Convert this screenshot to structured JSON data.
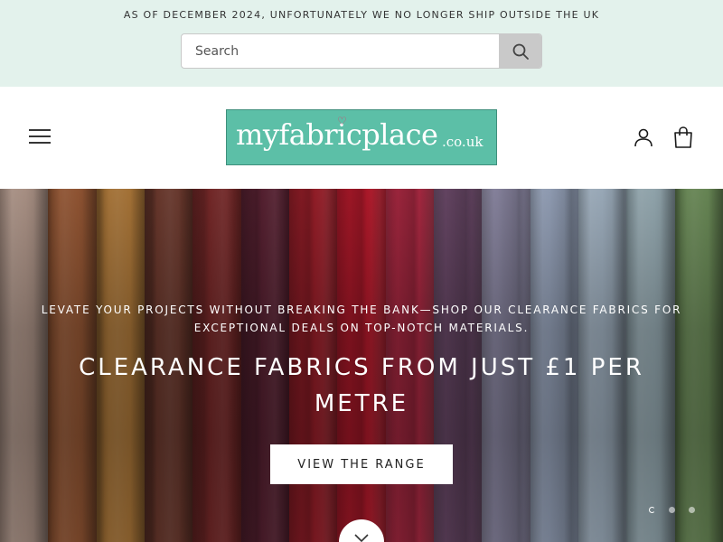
{
  "announcement": {
    "text": "AS OF DECEMBER 2024, UNFORTUNATELY WE NO LONGER SHIP OUTSIDE THE UK"
  },
  "search": {
    "placeholder": "Search",
    "value": ""
  },
  "header": {
    "logo": {
      "name": "myfabricplace",
      "tld": ".co.uk"
    }
  },
  "hero": {
    "subtitle": "LEVATE YOUR PROJECTS WITHOUT BREAKING THE BANK—SHOP OUR CLEARANCE FABRICS FOR EXCEPTIONAL DEALS ON TOP-NOTCH MATERIALS.",
    "title": "CLEARANCE FABRICS FROM JUST £1 PER METRE",
    "button_label": "VIEW THE RANGE",
    "slides": 3,
    "active_slide": 1
  },
  "icons": {
    "menu": "hamburger-menu-icon",
    "search": "magnifier-icon",
    "account": "user-icon",
    "cart": "shopping-bag-icon",
    "scroll": "chevron-down-icon"
  },
  "colors": {
    "announcement_bg": "#e3f2ec",
    "logo_bg": "#5cbfa7",
    "search_button_bg": "#c9c9c9",
    "fabric_rolls": [
      "#b49a8d",
      "#9a5a36",
      "#b07a3a",
      "#6e3a2e",
      "#7a2a2a",
      "#5a2233",
      "#9c1f2a",
      "#b81a2c",
      "#b02a44",
      "#6c4a6a",
      "#8e8aa6",
      "#9aa7bf",
      "#a5b6c6",
      "#9bb0b8",
      "#6e8f5a"
    ]
  }
}
